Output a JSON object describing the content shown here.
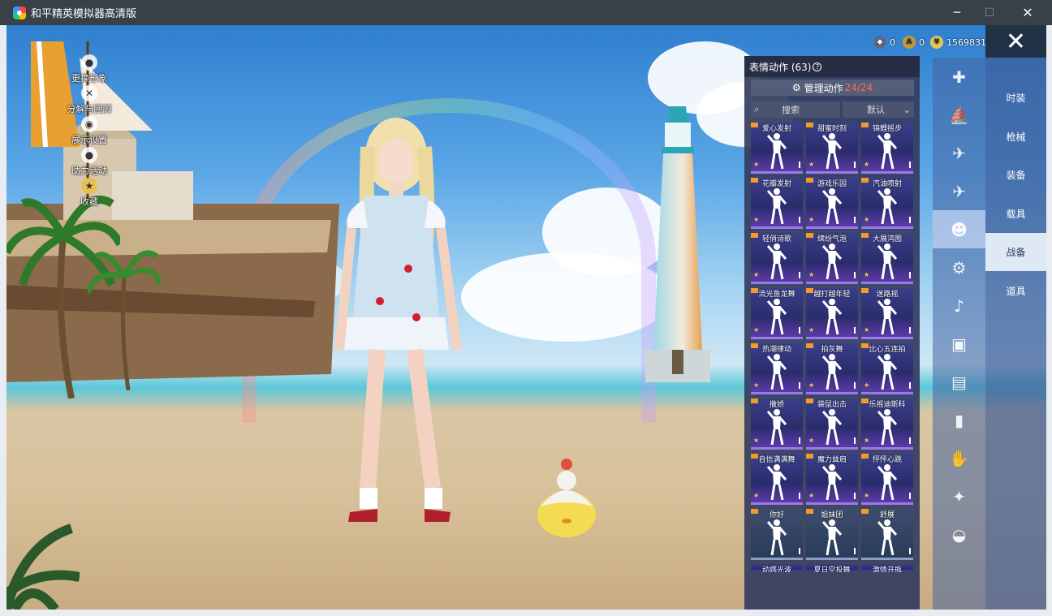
{
  "window": {
    "title": "和平精英模拟器高清版",
    "controls": [
      "─",
      "☐",
      "✕"
    ]
  },
  "left_actions": [
    {
      "label": "更换形象",
      "icon": "person-icon"
    },
    {
      "label": "分解与回顾",
      "icon": "wrench-icon"
    },
    {
      "label": "展示设置",
      "icon": "eye-icon"
    },
    {
      "label": "助力活动",
      "icon": "person-icon"
    },
    {
      "label": "收藏",
      "icon": "medal-icon"
    }
  ],
  "currencies": [
    {
      "icon": "medal-coin-icon",
      "value": "0",
      "color": "#5a6a8a"
    },
    {
      "icon": "gold-a-coin-icon",
      "value": "0",
      "color": "#c89a3a"
    },
    {
      "icon": "yuan-coin-icon",
      "value": "1569831",
      "color": "#e8c850"
    }
  ],
  "close_icon": "close-icon",
  "panel": {
    "title": "表情动作 (63)",
    "help": "?",
    "manage_label": "管理动作",
    "manage_count": "24/24",
    "search_placeholder": "搜索",
    "sort_label": "默认",
    "emotes": [
      {
        "name": "爱心发射",
        "style": "purple"
      },
      {
        "name": "甜蜜时刻",
        "style": "purple"
      },
      {
        "name": "锦鲤摇步",
        "style": "purple"
      },
      {
        "name": "花瓣发射",
        "style": "purple"
      },
      {
        "name": "游戏乐园",
        "style": "purple"
      },
      {
        "name": "汽油喷射",
        "style": "purple"
      },
      {
        "name": "轻俏诗歌",
        "style": "purple"
      },
      {
        "name": "缤纷气泡",
        "style": "purple"
      },
      {
        "name": "大展鸿图",
        "style": "purple"
      },
      {
        "name": "流光鱼龙舞",
        "style": "purple"
      },
      {
        "name": "越打越年轻",
        "style": "purple"
      },
      {
        "name": "迷路摇",
        "style": "purple"
      },
      {
        "name": "热潮律动",
        "style": "purple"
      },
      {
        "name": "拍灰舞",
        "style": "purple"
      },
      {
        "name": "比心五连拍",
        "style": "purple"
      },
      {
        "name": "撒娇",
        "style": "purple"
      },
      {
        "name": "袋鼠出击",
        "style": "purple"
      },
      {
        "name": "乐摇迪斯科",
        "style": "purple"
      },
      {
        "name": "自信满满舞",
        "style": "purple"
      },
      {
        "name": "魔力耸肩",
        "style": "purple"
      },
      {
        "name": "怦怦心跳",
        "style": "purple"
      },
      {
        "name": "你好",
        "style": "plain"
      },
      {
        "name": "姐妹团",
        "style": "plain"
      },
      {
        "name": "舒展",
        "style": "plain"
      },
      {
        "name": "动感光波",
        "style": "partial"
      },
      {
        "name": "夏日空投舞",
        "style": "partial"
      },
      {
        "name": "激情开瓶",
        "style": "partial"
      }
    ]
  },
  "category_icons": [
    "bandage-icon",
    "boat-icon",
    "drone-icon",
    "plane-icon",
    "pet-icon",
    "robot-icon",
    "speaker-icon",
    "toaster-icon",
    "photo-icon",
    "spray-icon",
    "hand-icon",
    "wand-icon",
    "hat-icon"
  ],
  "tabs": [
    {
      "label": "时装",
      "active": false
    },
    {
      "label": "枪械",
      "active": false
    },
    {
      "label": "装备",
      "active": false
    },
    {
      "label": "载具",
      "active": false
    },
    {
      "label": "战备",
      "active": true
    },
    {
      "label": "道具",
      "active": false
    }
  ]
}
